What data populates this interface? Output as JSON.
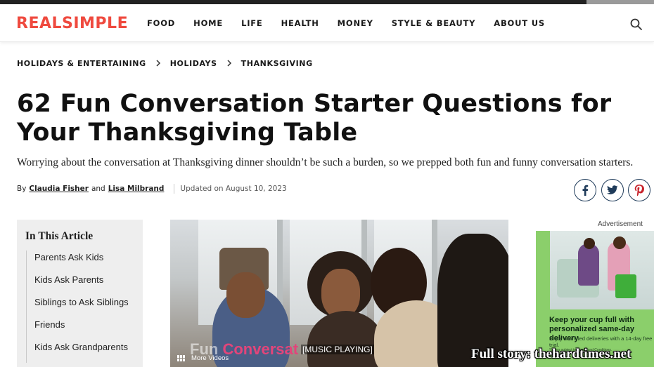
{
  "header": {
    "logo": "REALSIMPLE",
    "nav": [
      "FOOD",
      "HOME",
      "LIFE",
      "HEALTH",
      "MONEY",
      "STYLE & BEAUTY",
      "ABOUT US"
    ],
    "search_icon": "search-icon"
  },
  "breadcrumb": [
    "HOLIDAYS & ENTERTAINING",
    "HOLIDAYS",
    "THANKSGIVING"
  ],
  "article": {
    "title": "62 Fun Conversation Starter Questions for Your Thanksgiving Table",
    "dek": "Worrying about the conversation at Thanksgiving dinner shouldn’t be such a burden, so we prepped both fun and funny conversation starters.",
    "byline_prefix": "By",
    "author1": "Claudia Fisher",
    "byline_and": "and",
    "author2": "Lisa Milbrand",
    "updated": "Updated on August 10, 2023"
  },
  "share": [
    "facebook-icon",
    "twitter-icon",
    "pinterest-icon"
  ],
  "toc": {
    "title": "In This Article",
    "items": [
      "Parents Ask Kids",
      "Kids Ask Parents",
      "Siblings to Ask Siblings",
      "Friends",
      "Kids Ask Grandparents"
    ]
  },
  "video": {
    "caption": "[MUSIC PLAYING]",
    "overlay_word1": "Fun",
    "overlay_word2": "Conversat",
    "more_label": "More Videos"
  },
  "ad": {
    "label": "Advertisement",
    "headline": "Keep your cup full with personalized same-day delivery",
    "sub": "Enjoy unlimited deliveries with a 14-day free trial.",
    "fine": "*Offers subject to Terms and Conditions."
  },
  "watermark": "Full story: thehardtimes.net",
  "colors": {
    "brand": "#ef4a3f",
    "share_border": "#1f3b5a",
    "ad_green": "#8bcf6b"
  }
}
